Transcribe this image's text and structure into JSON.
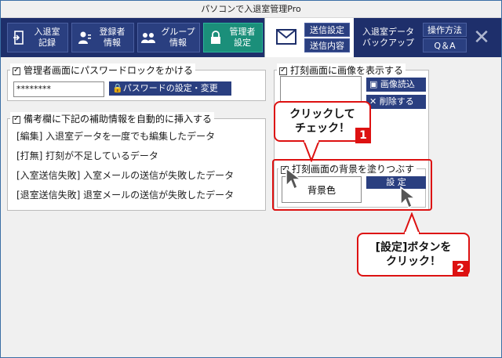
{
  "window": {
    "title": "パソコンで入退室管理Pro"
  },
  "toolbar": {
    "buttons": [
      {
        "label": "入退室\n記録",
        "icon": "door-icon"
      },
      {
        "label": "登録者\n情報",
        "icon": "person-icon"
      },
      {
        "label": "グループ\n情報",
        "icon": "group-icon"
      },
      {
        "label": "管理者\n設定",
        "icon": "lock-icon"
      }
    ],
    "mail_send_settings": "送信設定",
    "mail_send_content": "送信内容",
    "data_backup": "入退室データ\nバックアップ",
    "how_to": "操作方法",
    "qa": "Q＆A",
    "close": "✕"
  },
  "password_group": {
    "title": "管理者画面にパスワードロックをかける",
    "password_value": "********",
    "set_button": "パスワードの設定・変更"
  },
  "notes_group": {
    "title": "備考欄に下記の補助情報を自動的に挿入する",
    "lines": [
      "[編集]  入退室データを一度でも編集したデータ",
      "[打無]  打刻が不足しているデータ",
      "[入室送信失敗]  入室メールの送信が失敗したデータ",
      "[退室送信失敗]  退室メールの送信が失敗したデータ"
    ]
  },
  "image_group": {
    "title": "打刻画面に画像を表示する",
    "load_button": "画像読込",
    "delete_button": "削除する"
  },
  "background_group": {
    "title": "打刻画面の背景を塗りつぶす",
    "color_label": "背景色",
    "set_button": "設 定"
  },
  "annotations": {
    "callout1": "クリックして\nチェック！",
    "callout2": "[設定]ボタンを\nクリック！",
    "badge1": "1",
    "badge2": "2"
  },
  "colors": {
    "toolbar_bg": "#1e2f6b",
    "active_tab": "#1b8f7a",
    "accent_red": "#dd1111",
    "button_blue": "#2a3f80"
  }
}
